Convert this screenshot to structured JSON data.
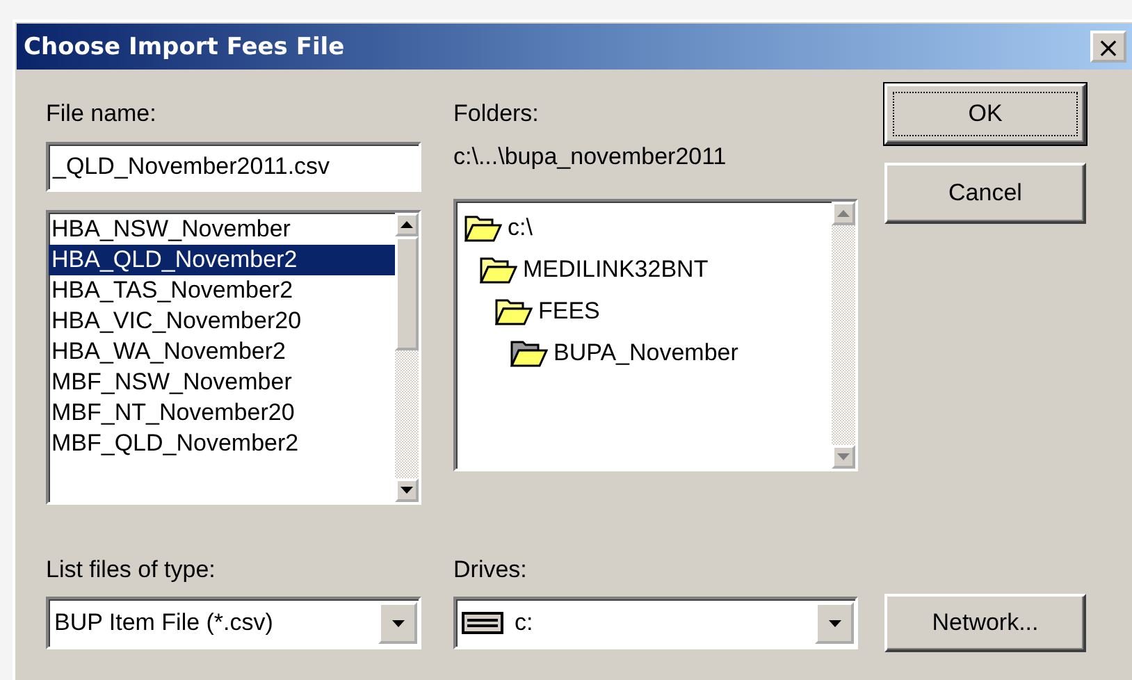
{
  "window": {
    "title": "Choose Import Fees File",
    "close": "×"
  },
  "file_name": {
    "label": "File name:",
    "value": "_QLD_November2011.csv"
  },
  "files": [
    {
      "name": "HBA_NSW_November",
      "selected": false
    },
    {
      "name": "HBA_QLD_November2",
      "selected": true
    },
    {
      "name": "HBA_TAS_November2",
      "selected": false
    },
    {
      "name": "HBA_VIC_November20",
      "selected": false
    },
    {
      "name": "HBA_WA_November2",
      "selected": false
    },
    {
      "name": "MBF_NSW_November",
      "selected": false
    },
    {
      "name": "MBF_NT_November20",
      "selected": false
    },
    {
      "name": "MBF_QLD_November2",
      "selected": false
    }
  ],
  "folders": {
    "label": "Folders:",
    "path": "c:\\...\\bupa_november2011",
    "tree": [
      {
        "name": "c:\\",
        "selected": false,
        "children": [
          {
            "name": "MEDILINK32BNT",
            "selected": false,
            "children": [
              {
                "name": "FEES",
                "selected": false,
                "children": [
                  {
                    "name": "BUPA_November",
                    "selected": true
                  }
                ]
              }
            ]
          }
        ]
      }
    ]
  },
  "file_type": {
    "label": "List files of type:",
    "value": "BUP Item File (*.csv)"
  },
  "drives": {
    "label": "Drives:",
    "value": "c:"
  },
  "buttons": [
    {
      "label": "OK",
      "default": true
    },
    {
      "label": "Cancel",
      "default": false
    }
  ],
  "network_button": "Network..."
}
